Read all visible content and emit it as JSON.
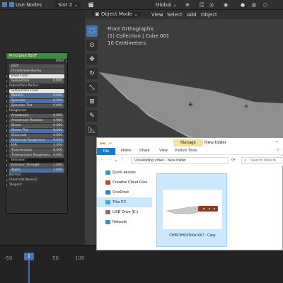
{
  "topbar": {
    "use_nodes_label": "Use Nodes",
    "slot_label": "Slot 2",
    "transform_label": "Global",
    "object_mode_label": "Object Mode",
    "menus": [
      "View",
      "Select",
      "Add",
      "Object"
    ]
  },
  "node": {
    "title": "Principled BSDF",
    "output_label": "BSDF",
    "distribution": "GGX",
    "subsurface_method": "Christensen-Burley",
    "rows": [
      {
        "label": "Base Color",
        "style": "white",
        "value": ""
      },
      {
        "label": "Subsurface",
        "style": "grey",
        "value": "0.000"
      },
      {
        "label": "Subsurface Radius",
        "style": "none",
        "value": ""
      },
      {
        "label": "Subsurface Color",
        "style": "white",
        "value": ""
      },
      {
        "label": "Metallic",
        "style": "blue",
        "value": "0.000"
      },
      {
        "label": "Specular",
        "style": "blue",
        "value": "0.500"
      },
      {
        "label": "Specular Tint",
        "style": "grey",
        "value": "0.000"
      },
      {
        "label": "Roughness",
        "style": "none",
        "value": ""
      },
      {
        "label": "Anisotropic",
        "style": "grey",
        "value": "0.000"
      },
      {
        "label": "Anisotropic Rotation",
        "style": "grey",
        "value": "0.000"
      },
      {
        "label": "Sheen",
        "style": "grey",
        "value": "0.000"
      },
      {
        "label": "Sheen Tint",
        "style": "blue",
        "value": "0.500"
      },
      {
        "label": "Clearcoat",
        "style": "grey",
        "value": "0.000"
      },
      {
        "label": "Clearcoat Roughness",
        "style": "blue",
        "value": "0.030"
      },
      {
        "label": "IOR",
        "style": "grey",
        "value": "1.450"
      },
      {
        "label": "Transmission",
        "style": "grey",
        "value": "0.000"
      },
      {
        "label": "Transmission Roughness",
        "style": "grey",
        "value": "0.000"
      },
      {
        "label": "Emission",
        "style": "dark",
        "value": ""
      },
      {
        "label": "Emission Strength",
        "style": "grey",
        "value": "1.000"
      },
      {
        "label": "Alpha",
        "style": "blue",
        "value": "1.000"
      },
      {
        "label": "Normal",
        "style": "none",
        "value": ""
      },
      {
        "label": "Clearcoat Normal",
        "style": "none",
        "value": ""
      },
      {
        "label": "Tangent",
        "style": "none",
        "value": ""
      }
    ]
  },
  "viewport": {
    "view_name": "Front Orthographic",
    "collection": "(1) Collection | Cube.001",
    "scale": "10 Centimeters"
  },
  "timeline": {
    "ticks": [
      "-50",
      "1",
      "50",
      "100"
    ],
    "current_frame": "1"
  },
  "explorer": {
    "manage_label": "Manage",
    "window_title": "New folder",
    "ribbon_tabs": [
      "File",
      "Home",
      "Share",
      "View",
      "Picture Tools"
    ],
    "address": "Unsatisfing video  ›  New folder",
    "search_placeholder": "Search New fo",
    "nav_items": [
      {
        "label": "Quick access",
        "icon": "star-icon",
        "color": "#3b8fd9"
      },
      {
        "label": "Creative Cloud Files",
        "icon": "cloud-icon",
        "color": "#da3b2e"
      },
      {
        "label": "OneDrive",
        "icon": "onedrive-icon",
        "color": "#2f7fd9"
      },
      {
        "label": "This PC",
        "icon": "pc-icon",
        "color": "#4aa0e0"
      },
      {
        "label": "USB Drive (E:)",
        "icon": "usb-icon",
        "color": "#777777"
      },
      {
        "label": "Network",
        "icon": "network-icon",
        "color": "#3b8fd9"
      }
    ],
    "selected_nav": "This PC",
    "file_name": "CHBCIIHO2500x1667 - Copy"
  },
  "colors": {
    "accent_blue": "#4772b3",
    "node_header_green": "#3d8b3d",
    "explorer_select": "#cce8ff"
  }
}
